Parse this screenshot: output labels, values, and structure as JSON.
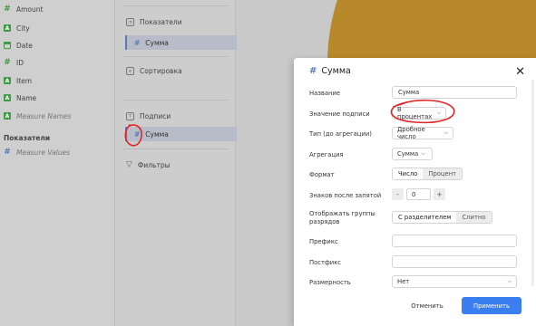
{
  "fields": [
    {
      "label": "Amount",
      "icon": "measure-hash-icon"
    },
    {
      "label": "City",
      "icon": "string-type-icon"
    },
    {
      "label": "Date",
      "icon": "calendar-icon"
    },
    {
      "label": "ID",
      "icon": "measure-hash-icon"
    },
    {
      "label": "Item",
      "icon": "string-type-icon"
    },
    {
      "label": "Name",
      "icon": "string-type-icon"
    },
    {
      "label": "Measure Names",
      "icon": "string-type-icon"
    }
  ],
  "measures_section": {
    "title": "Показатели",
    "item": "Measure Values"
  },
  "middle": {
    "measures_title": "Показатели",
    "measures_pill": "Сумма",
    "sort_title": "Сортировка",
    "labels_title": "Подписи",
    "labels_pill": "Сумма",
    "filters_title": "Фильтры"
  },
  "modal": {
    "title": "Сумма",
    "name_label": "Название",
    "name_value": "Сумма",
    "label_value_label": "Значение подписи",
    "label_value_select": "В процентах",
    "type_label": "Тип (до агрегации)",
    "type_select": "Дробное число",
    "agg_label": "Агрегация",
    "agg_select": "Сумма",
    "format_label": "Формат",
    "format_options": [
      "Число",
      "Процент"
    ],
    "decimals_label": "Знаков после запятой",
    "decimals_value": "0",
    "decimals_minus": "-",
    "decimals_plus": "+",
    "group_label": "Отображать группы разрядов",
    "group_options": [
      "С разделителем",
      "Слитно"
    ],
    "prefix_label": "Префикс",
    "postfix_label": "Постфикс",
    "unit_label": "Размерность",
    "unit_select": "Нет",
    "cancel": "Отменить",
    "apply": "Применить"
  },
  "colors": {
    "accent": "#3b7ef0",
    "annotation": "#e0262b",
    "field_icon": "#3f9a44",
    "measure_icon": "#5b79b6"
  }
}
